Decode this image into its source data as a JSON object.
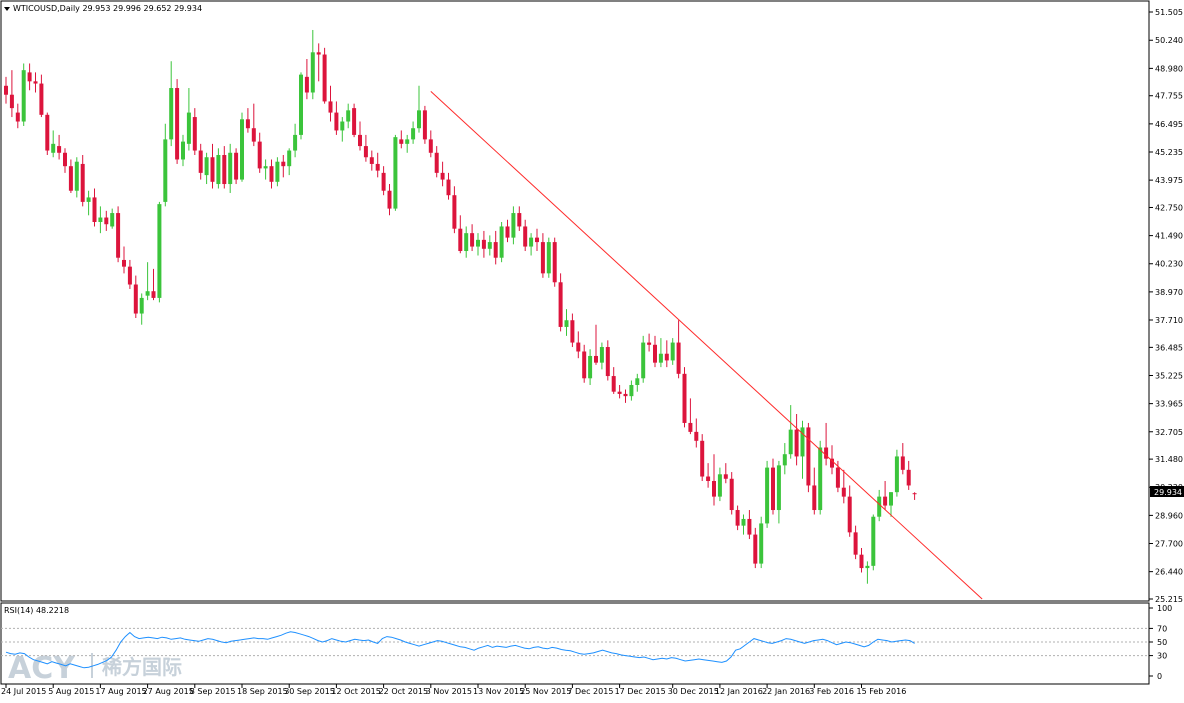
{
  "chart_data": {
    "type": "candlestick",
    "symbol_line": "WTICOUSD,Daily  29.953 29.996 29.652 29.934",
    "current_price": "29.934",
    "price_axis_ticks": [
      "51.505",
      "50.240",
      "48.980",
      "47.755",
      "46.495",
      "45.235",
      "43.975",
      "42.750",
      "41.490",
      "40.230",
      "38.970",
      "37.710",
      "36.485",
      "35.225",
      "33.965",
      "32.705",
      "31.480",
      "30.220",
      "28.960",
      "27.700",
      "26.440",
      "25.215"
    ],
    "price_range": [
      25.215,
      51.505
    ],
    "date_ticks": [
      "24 Jul 2015",
      "5 Aug 2015",
      "17 Aug 2015",
      "27 Aug 2015",
      "8 Sep 2015",
      "18 Sep 2015",
      "30 Sep 2015",
      "12 Oct 2015",
      "22 Oct 2015",
      "3 Nov 2015",
      "13 Nov 2015",
      "25 Nov 2015",
      "7 Dec 2015",
      "17 Dec 2015",
      "30 Dec 2015",
      "12 Jan 2016",
      "22 Jan 2016",
      "3 Feb 2016",
      "15 Feb 2016"
    ],
    "colors": {
      "up": "#3bc43b",
      "down": "#dc143c",
      "trendline": "#ff2a2a",
      "rsi_line": "#1e90ff"
    },
    "candles": [
      [
        48.2,
        48.6,
        47.4,
        47.8
      ],
      [
        47.8,
        48.9,
        46.8,
        47.2
      ],
      [
        47.0,
        47.4,
        46.3,
        46.6
      ],
      [
        46.6,
        49.2,
        46.4,
        48.9
      ],
      [
        48.8,
        49.2,
        48.0,
        48.4
      ],
      [
        48.4,
        48.8,
        47.9,
        48.3
      ],
      [
        48.3,
        48.7,
        46.8,
        46.9
      ],
      [
        46.9,
        47.0,
        45.1,
        45.3
      ],
      [
        45.2,
        46.2,
        45.0,
        45.6
      ],
      [
        45.5,
        46.0,
        44.9,
        45.2
      ],
      [
        45.2,
        45.4,
        44.3,
        44.6
      ],
      [
        44.6,
        44.9,
        43.4,
        43.5
      ],
      [
        43.5,
        45.0,
        43.2,
        44.8
      ],
      [
        44.7,
        45.1,
        42.8,
        43.0
      ],
      [
        43.0,
        43.5,
        42.4,
        43.2
      ],
      [
        43.2,
        43.6,
        41.9,
        42.1
      ],
      [
        42.1,
        42.8,
        41.6,
        42.3
      ],
      [
        42.3,
        42.6,
        41.7,
        42.0
      ],
      [
        41.9,
        42.7,
        41.8,
        42.5
      ],
      [
        42.5,
        42.8,
        40.3,
        40.5
      ],
      [
        40.4,
        41.0,
        39.8,
        40.1
      ],
      [
        40.1,
        40.4,
        39.1,
        39.3
      ],
      [
        39.3,
        39.7,
        37.8,
        38.0
      ],
      [
        38.0,
        38.9,
        37.5,
        38.7
      ],
      [
        38.8,
        40.3,
        38.6,
        39.0
      ],
      [
        39.0,
        40.0,
        38.6,
        38.7
      ],
      [
        38.7,
        43.0,
        38.5,
        42.9
      ],
      [
        43.0,
        46.5,
        42.8,
        45.8
      ],
      [
        45.8,
        49.3,
        45.5,
        48.1
      ],
      [
        48.1,
        48.5,
        44.7,
        44.9
      ],
      [
        44.9,
        46.0,
        44.6,
        45.7
      ],
      [
        45.6,
        48.1,
        45.3,
        47.0
      ],
      [
        46.8,
        47.2,
        45.1,
        45.3
      ],
      [
        45.3,
        45.6,
        44.0,
        44.3
      ],
      [
        44.2,
        45.2,
        43.8,
        45.0
      ],
      [
        45.0,
        45.6,
        43.6,
        43.9
      ],
      [
        43.8,
        45.4,
        43.6,
        45.1
      ],
      [
        45.1,
        45.5,
        43.6,
        43.8
      ],
      [
        43.8,
        45.6,
        43.4,
        45.2
      ],
      [
        45.2,
        45.4,
        43.8,
        44.0
      ],
      [
        44.0,
        47.0,
        43.9,
        46.7
      ],
      [
        46.7,
        47.2,
        46.1,
        46.3
      ],
      [
        46.3,
        47.4,
        45.5,
        45.7
      ],
      [
        45.7,
        46.1,
        44.3,
        44.5
      ],
      [
        44.5,
        44.9,
        44.0,
        44.6
      ],
      [
        44.6,
        44.9,
        43.6,
        43.9
      ],
      [
        43.9,
        45.0,
        43.7,
        44.8
      ],
      [
        44.8,
        45.1,
        44.1,
        44.6
      ],
      [
        44.6,
        45.4,
        44.2,
        45.3
      ],
      [
        45.3,
        46.5,
        45.0,
        46.0
      ],
      [
        46.0,
        48.8,
        45.8,
        48.7
      ],
      [
        48.6,
        49.4,
        47.6,
        47.9
      ],
      [
        47.9,
        50.7,
        47.6,
        49.7
      ],
      [
        49.7,
        50.1,
        48.4,
        49.6
      ],
      [
        49.6,
        49.9,
        47.4,
        47.5
      ],
      [
        47.5,
        48.2,
        46.6,
        47.0
      ],
      [
        47.0,
        47.5,
        46.0,
        46.2
      ],
      [
        46.2,
        46.8,
        45.7,
        46.6
      ],
      [
        46.6,
        47.4,
        46.3,
        47.1
      ],
      [
        47.2,
        47.4,
        45.9,
        46.0
      ],
      [
        46.0,
        46.6,
        45.3,
        45.5
      ],
      [
        45.5,
        46.0,
        44.8,
        45.0
      ],
      [
        45.0,
        45.3,
        44.4,
        44.7
      ],
      [
        44.7,
        45.2,
        44.1,
        44.4
      ],
      [
        44.3,
        44.6,
        43.3,
        43.5
      ],
      [
        43.5,
        43.8,
        42.4,
        42.7
      ],
      [
        42.7,
        46.0,
        42.6,
        45.9
      ],
      [
        45.8,
        46.2,
        45.4,
        45.6
      ],
      [
        45.6,
        46.0,
        45.2,
        45.8
      ],
      [
        45.8,
        46.6,
        45.6,
        46.3
      ],
      [
        46.3,
        48.2,
        46.1,
        47.1
      ],
      [
        47.1,
        47.3,
        45.6,
        45.8
      ],
      [
        45.8,
        46.2,
        45.0,
        45.2
      ],
      [
        45.2,
        45.5,
        44.1,
        44.3
      ],
      [
        44.3,
        44.8,
        43.7,
        44.0
      ],
      [
        44.0,
        44.3,
        43.1,
        43.3
      ],
      [
        43.3,
        43.7,
        41.6,
        41.8
      ],
      [
        41.8,
        42.4,
        40.7,
        40.8
      ],
      [
        40.8,
        41.9,
        40.5,
        41.6
      ],
      [
        41.6,
        42.0,
        40.8,
        41.0
      ],
      [
        41.0,
        41.6,
        40.6,
        41.3
      ],
      [
        41.3,
        41.7,
        40.5,
        40.9
      ],
      [
        40.9,
        41.5,
        40.6,
        41.2
      ],
      [
        41.2,
        41.7,
        40.2,
        40.5
      ],
      [
        40.5,
        42.1,
        40.3,
        41.9
      ],
      [
        41.9,
        42.2,
        41.2,
        41.4
      ],
      [
        41.4,
        42.8,
        41.1,
        42.5
      ],
      [
        42.5,
        42.8,
        41.7,
        41.9
      ],
      [
        41.9,
        42.2,
        40.8,
        41.0
      ],
      [
        41.0,
        41.6,
        40.6,
        41.4
      ],
      [
        41.4,
        41.8,
        40.8,
        41.2
      ],
      [
        41.2,
        41.6,
        39.6,
        39.8
      ],
      [
        39.8,
        41.4,
        39.6,
        41.2
      ],
      [
        41.2,
        41.4,
        39.2,
        39.4
      ],
      [
        39.4,
        39.8,
        37.2,
        37.4
      ],
      [
        37.4,
        38.2,
        37.0,
        37.7
      ],
      [
        37.7,
        38.0,
        36.5,
        36.7
      ],
      [
        36.7,
        37.2,
        36.0,
        36.3
      ],
      [
        36.3,
        36.6,
        34.9,
        35.1
      ],
      [
        35.1,
        36.4,
        34.8,
        36.1
      ],
      [
        36.1,
        37.5,
        35.7,
        35.8
      ],
      [
        35.8,
        36.7,
        35.5,
        36.5
      ],
      [
        36.5,
        36.8,
        35.0,
        35.2
      ],
      [
        35.2,
        35.6,
        34.4,
        34.5
      ],
      [
        34.5,
        34.8,
        34.2,
        34.4
      ],
      [
        34.4,
        34.6,
        34.0,
        34.3
      ],
      [
        34.3,
        35.0,
        34.1,
        34.8
      ],
      [
        34.8,
        35.3,
        34.5,
        35.1
      ],
      [
        35.1,
        37.0,
        34.9,
        36.7
      ],
      [
        36.7,
        37.1,
        36.3,
        36.6
      ],
      [
        36.6,
        37.0,
        35.6,
        35.8
      ],
      [
        35.8,
        36.9,
        35.6,
        36.2
      ],
      [
        36.2,
        36.8,
        35.6,
        35.9
      ],
      [
        35.9,
        36.9,
        35.7,
        36.7
      ],
      [
        36.7,
        37.7,
        35.1,
        35.3
      ],
      [
        35.3,
        35.6,
        32.9,
        33.1
      ],
      [
        33.1,
        34.2,
        32.6,
        32.7
      ],
      [
        32.7,
        33.3,
        32.0,
        32.3
      ],
      [
        32.3,
        32.6,
        30.5,
        30.7
      ],
      [
        30.7,
        31.3,
        30.2,
        30.5
      ],
      [
        30.5,
        31.7,
        29.4,
        29.8
      ],
      [
        29.8,
        31.1,
        29.6,
        30.8
      ],
      [
        30.8,
        31.3,
        30.4,
        30.6
      ],
      [
        30.6,
        30.9,
        29.0,
        29.2
      ],
      [
        29.2,
        29.4,
        28.3,
        28.5
      ],
      [
        28.5,
        29.0,
        28.1,
        28.8
      ],
      [
        28.8,
        29.2,
        27.9,
        28.1
      ],
      [
        28.1,
        28.4,
        26.6,
        26.8
      ],
      [
        26.8,
        28.9,
        26.6,
        28.6
      ],
      [
        28.6,
        31.4,
        28.4,
        31.1
      ],
      [
        31.1,
        31.5,
        29.0,
        29.2
      ],
      [
        29.2,
        31.4,
        28.6,
        31.2
      ],
      [
        31.2,
        32.2,
        30.8,
        31.7
      ],
      [
        31.7,
        33.9,
        31.5,
        32.8
      ],
      [
        32.8,
        33.5,
        31.2,
        31.6
      ],
      [
        31.6,
        33.2,
        30.6,
        32.9
      ],
      [
        32.9,
        33.1,
        30.0,
        30.3
      ],
      [
        30.3,
        31.1,
        29.0,
        29.2
      ],
      [
        29.2,
        32.3,
        29.0,
        32.0
      ],
      [
        32.0,
        33.1,
        31.2,
        31.5
      ],
      [
        31.5,
        32.1,
        30.8,
        31.1
      ],
      [
        31.1,
        31.4,
        30.0,
        30.2
      ],
      [
        30.2,
        31.0,
        29.5,
        29.8
      ],
      [
        29.8,
        30.3,
        28.0,
        28.2
      ],
      [
        28.2,
        28.5,
        27.0,
        27.2
      ],
      [
        27.2,
        27.5,
        26.4,
        26.6
      ],
      [
        26.6,
        26.9,
        25.9,
        26.7
      ],
      [
        26.7,
        29.0,
        26.5,
        28.9
      ],
      [
        28.9,
        30.1,
        28.7,
        29.8
      ],
      [
        29.8,
        30.5,
        29.2,
        29.4
      ],
      [
        29.4,
        30.0,
        28.9,
        30.0
      ],
      [
        30.0,
        31.9,
        29.8,
        31.6
      ],
      [
        31.6,
        32.2,
        30.8,
        31.0
      ],
      [
        31.0,
        31.4,
        30.1,
        30.3
      ],
      [
        29.953,
        29.996,
        29.652,
        29.934
      ]
    ],
    "trendline": {
      "from": {
        "date": "3 Nov 2015",
        "price": 47.95
      },
      "to": {
        "price": 25.215
      }
    },
    "rsi": {
      "label": "RSI(14) 48.2218",
      "levels": [
        70,
        50,
        30
      ],
      "axis_ticks": [
        "100",
        "70",
        "50",
        "30",
        "0"
      ],
      "range": [
        0,
        100
      ],
      "values": [
        35,
        33,
        32,
        34,
        33,
        28,
        24,
        22,
        20,
        18,
        21,
        19,
        17,
        15,
        18,
        16,
        14,
        12,
        13,
        15,
        17,
        20,
        23,
        28,
        38,
        50,
        58,
        64,
        58,
        55,
        56,
        57,
        56,
        55,
        57,
        56,
        54,
        55,
        56,
        54,
        53,
        52,
        51,
        53,
        55,
        54,
        52,
        50,
        49,
        51,
        52,
        53,
        54,
        55,
        56,
        55,
        55,
        54,
        56,
        58,
        60,
        63,
        65,
        64,
        62,
        60,
        58,
        55,
        52,
        50,
        52,
        55,
        53,
        51,
        50,
        52,
        54,
        53,
        52,
        53,
        50,
        48,
        55,
        58,
        57,
        55,
        53,
        50,
        48,
        46,
        44,
        46,
        48,
        50,
        52,
        51,
        49,
        47,
        45,
        43,
        42,
        40,
        38,
        41,
        43,
        45,
        42,
        44,
        43,
        42,
        44,
        45,
        43,
        41,
        40,
        42,
        43,
        41,
        40,
        42,
        41,
        39,
        38,
        37,
        35,
        33,
        32,
        33,
        34,
        36,
        38,
        36,
        34,
        33,
        31,
        30,
        29,
        28,
        27,
        28,
        26,
        24,
        25,
        26,
        25,
        27,
        26,
        24,
        22,
        23,
        24,
        25,
        24,
        23,
        22,
        21,
        20,
        22,
        28,
        38,
        40,
        45,
        50,
        55,
        53,
        51,
        49,
        48,
        50,
        52,
        55,
        54,
        52,
        50,
        48,
        50,
        52,
        53,
        54,
        52,
        49,
        46,
        48,
        50,
        49,
        47,
        45,
        43,
        45,
        50,
        54,
        53,
        52,
        50,
        51,
        52,
        53,
        52,
        48
      ]
    }
  },
  "watermark": {
    "brand": "ACY",
    "name": "稀方国际"
  }
}
